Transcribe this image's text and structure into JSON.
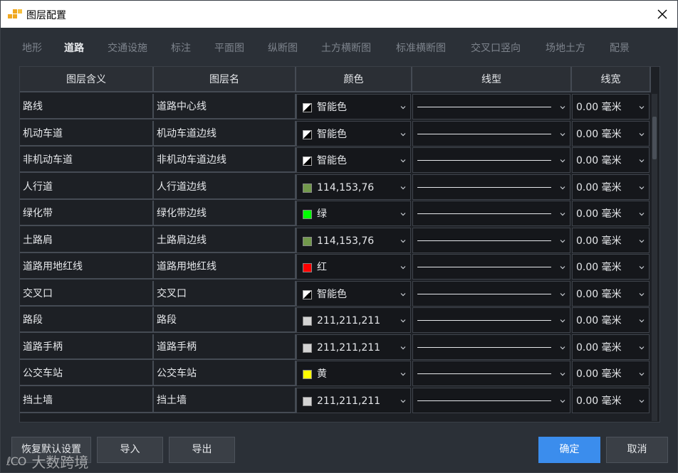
{
  "window": {
    "title": "图层配置",
    "close_glyph": "✕",
    "logo_icon": "app-logo-icon",
    "accent": "#3b8ded"
  },
  "tabs": [
    {
      "label": "地形",
      "active": false
    },
    {
      "label": "道路",
      "active": true
    },
    {
      "label": "交通设施",
      "active": false
    },
    {
      "label": "标注",
      "active": false
    },
    {
      "label": "平面图",
      "active": false
    },
    {
      "label": "纵断图",
      "active": false
    },
    {
      "label": "土方横断图",
      "active": false
    },
    {
      "label": "标准横断图",
      "active": false
    },
    {
      "label": "交叉口竖向",
      "active": false
    },
    {
      "label": "场地土方",
      "active": false
    },
    {
      "label": "配景",
      "active": false
    }
  ],
  "table": {
    "columns": [
      "图层含义",
      "图层名",
      "颜色",
      "线型",
      "线宽"
    ],
    "rows": [
      {
        "meaning": "路线",
        "layer": "道路中心线",
        "color_label": "智能色",
        "color_hex": "smart",
        "width": "0.00 毫米"
      },
      {
        "meaning": "机动车道",
        "layer": "机动车道边线",
        "color_label": "智能色",
        "color_hex": "smart",
        "width": "0.00 毫米"
      },
      {
        "meaning": "非机动车道",
        "layer": "非机动车道边线",
        "color_label": "智能色",
        "color_hex": "smart",
        "width": "0.00 毫米"
      },
      {
        "meaning": "人行道",
        "layer": "人行道边线",
        "color_label": "114,153,76",
        "color_hex": "#72994c",
        "width": "0.00 毫米"
      },
      {
        "meaning": "绿化带",
        "layer": "绿化带边线",
        "color_label": "绿",
        "color_hex": "#00ff00",
        "width": "0.00 毫米"
      },
      {
        "meaning": "土路肩",
        "layer": "土路肩边线",
        "color_label": "114,153,76",
        "color_hex": "#72994c",
        "width": "0.00 毫米"
      },
      {
        "meaning": "道路用地红线",
        "layer": "道路用地红线",
        "color_label": "红",
        "color_hex": "#ff0000",
        "width": "0.00 毫米"
      },
      {
        "meaning": "交叉口",
        "layer": "交叉口",
        "color_label": "智能色",
        "color_hex": "smart",
        "width": "0.00 毫米"
      },
      {
        "meaning": "路段",
        "layer": "路段",
        "color_label": "211,211,211",
        "color_hex": "#d3d3d3",
        "width": "0.00 毫米"
      },
      {
        "meaning": "道路手柄",
        "layer": "道路手柄",
        "color_label": "211,211,211",
        "color_hex": "#d3d3d3",
        "width": "0.00 毫米"
      },
      {
        "meaning": "公交车站",
        "layer": "公交车站",
        "color_label": "黄",
        "color_hex": "#ffff00",
        "width": "0.00 毫米"
      },
      {
        "meaning": "挡土墙",
        "layer": "挡土墙",
        "color_label": "211,211,211",
        "color_hex": "#d3d3d3",
        "width": "0.00 毫米"
      }
    ]
  },
  "buttons": {
    "restore_default": "恢复默认设置",
    "import": "导入",
    "export": "导出",
    "ok": "确定",
    "cancel": "取消"
  },
  "watermark": {
    "icon_text": "ℓCO",
    "text": "大数跨境"
  }
}
